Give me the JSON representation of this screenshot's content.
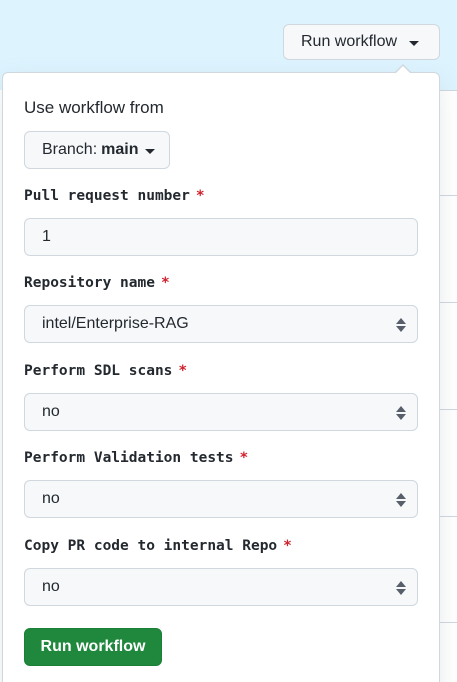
{
  "colors": {
    "banner": "#ddf4ff",
    "required": "#cf222e",
    "primary_button": "#1f883d"
  },
  "top_button": {
    "label": "Run workflow",
    "icon": "chevron-down-icon"
  },
  "popover": {
    "heading": "Use workflow from",
    "branch": {
      "prefix": "Branch:",
      "value": "main",
      "icon": "chevron-down-icon"
    },
    "fields": [
      {
        "label": "Pull request number",
        "required_mark": "*",
        "type": "text",
        "value": "1"
      },
      {
        "label": "Repository name",
        "required_mark": "*",
        "type": "select",
        "value": "intel/Enterprise-RAG"
      },
      {
        "label": "Perform SDL scans",
        "required_mark": "*",
        "type": "select",
        "value": "no"
      },
      {
        "label": "Perform Validation tests",
        "required_mark": "*",
        "type": "select",
        "value": "no"
      },
      {
        "label": "Copy PR code to internal Repo",
        "required_mark": "*",
        "type": "select",
        "value": "no"
      }
    ],
    "submit_label": "Run workflow"
  }
}
